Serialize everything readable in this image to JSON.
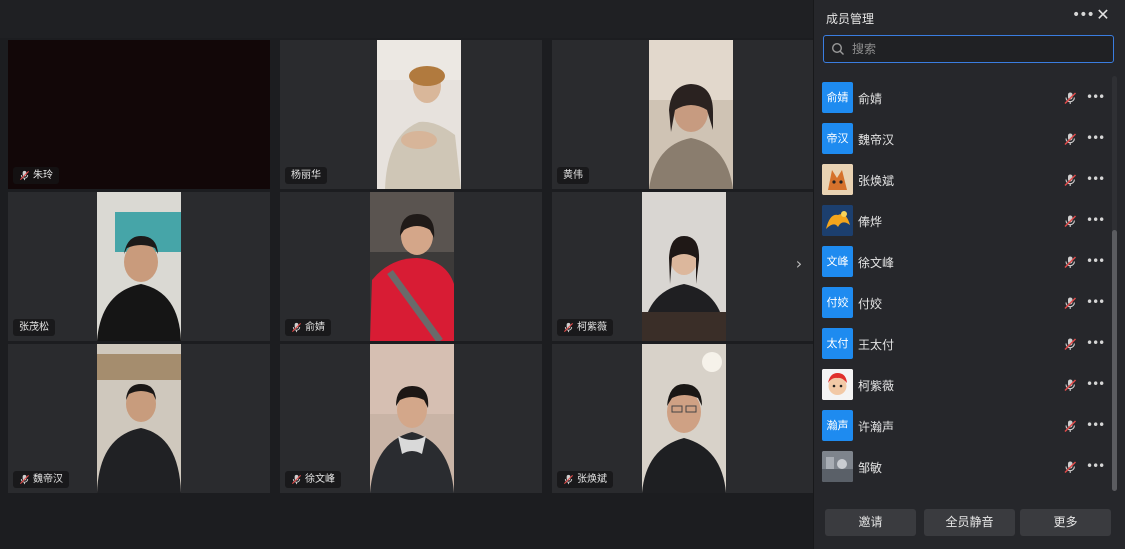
{
  "window": {
    "background": "#1e1f22"
  },
  "grid": {
    "tiles": [
      {
        "name": "朱玲",
        "muted": true
      },
      {
        "name": "杨丽华",
        "muted": false
      },
      {
        "name": "黄伟",
        "muted": false
      },
      {
        "name": "张茂松",
        "muted": false
      },
      {
        "name": "俞婧",
        "muted": true
      },
      {
        "name": "柯紫薇",
        "muted": true
      },
      {
        "name": "魏帝汉",
        "muted": true
      },
      {
        "name": "徐文峰",
        "muted": true
      },
      {
        "name": "张焕斌",
        "muted": true
      }
    ],
    "next_icon": "chevron-right-icon"
  },
  "panel": {
    "title": "成员管理",
    "more_icon": "ellipsis-icon",
    "close_icon": "close-icon",
    "search": {
      "placeholder": "搜索",
      "value": ""
    },
    "members": [
      {
        "name": "俞婧",
        "avatar_text": "俞婧",
        "avatar_color": "#1e8bf0"
      },
      {
        "name": "魏帝汉",
        "avatar_text": "帝汉",
        "avatar_color": "#1e8bf0"
      },
      {
        "name": "张焕斌",
        "avatar_text": "",
        "avatar_color": "#e8d0b0"
      },
      {
        "name": "俸烨",
        "avatar_text": "",
        "avatar_color": "#f0a020"
      },
      {
        "name": "徐文峰",
        "avatar_text": "文峰",
        "avatar_color": "#1e8bf0"
      },
      {
        "name": "付姣",
        "avatar_text": "付姣",
        "avatar_color": "#1e8bf0"
      },
      {
        "name": "王太付",
        "avatar_text": "太付",
        "avatar_color": "#1e8bf0"
      },
      {
        "name": "柯紫薇",
        "avatar_text": "",
        "avatar_color": "#f4f4f4"
      },
      {
        "name": "许瀚声",
        "avatar_text": "瀚声",
        "avatar_color": "#1e8bf0"
      },
      {
        "name": "邹敏",
        "avatar_text": "",
        "avatar_color": "#8a8f96"
      }
    ],
    "footer": {
      "invite": "邀请",
      "mute_all": "全员静音",
      "more": "更多"
    }
  }
}
